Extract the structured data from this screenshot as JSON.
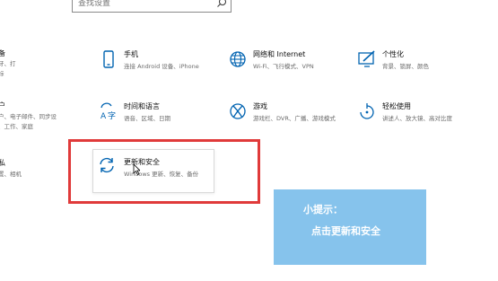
{
  "search": {
    "placeholder": "查找设置"
  },
  "left_column": {
    "row1_title": "备",
    "row1_desc_lines": [
      "牙、打",
      "标"
    ],
    "row2_title": "户",
    "row2_desc_lines": [
      "户、电子邮件、同步设",
      "、工作、家庭"
    ],
    "row3_title": "私",
    "row3_desc_lines": [
      "置、相机"
    ]
  },
  "tiles": [
    {
      "title": "手机",
      "desc": "连接 Android 设备、iPhone"
    },
    {
      "title": "网络和 Internet",
      "desc": "Wi-Fi、飞行模式、VPN"
    },
    {
      "title": "个性化",
      "desc": "背景、锁屏、颜色"
    },
    {
      "title": "时间和语言",
      "desc": "语音、区域、日期"
    },
    {
      "title": "游戏",
      "desc": "游戏栏、DVR、广播、游戏模式"
    },
    {
      "title": "轻松使用",
      "desc": "讲述人、放大镜、高对比度"
    }
  ],
  "update_tile": {
    "title": "更新和安全",
    "desc": "Windows 更新、恢复、备份"
  },
  "tip": {
    "line1": "小提示：",
    "line2": "点击更新和安全"
  },
  "colors": {
    "accent": "#0063b1",
    "highlight": "#e03a3a",
    "tip_bg": "#86c3ec"
  }
}
